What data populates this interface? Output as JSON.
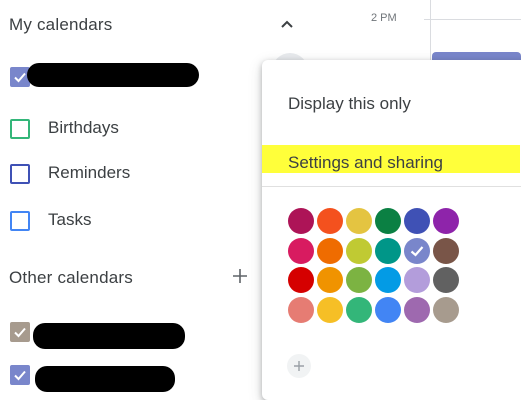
{
  "sidebar": {
    "my_calendars_title": "My calendars",
    "other_calendars_title": "Other calendars",
    "my_calendars": [
      {
        "label": "",
        "color": "#7986cb",
        "checked": true,
        "redacted": true
      },
      {
        "label": "Birthdays",
        "color": "#33b679",
        "checked": false
      },
      {
        "label": "Reminders",
        "color": "#3f51b5",
        "checked": false
      },
      {
        "label": "Tasks",
        "color": "#4285f4",
        "checked": false
      }
    ],
    "other_calendars": [
      {
        "label": "",
        "color": "#a79b8e",
        "checked": true,
        "redacted": true
      },
      {
        "label": "",
        "color": "#7986cb",
        "checked": true,
        "redacted": true
      }
    ]
  },
  "timegrid": {
    "time_label": "2 PM"
  },
  "menu": {
    "display_only": "Display this only",
    "settings_sharing": "Settings and sharing",
    "highlight_color": "#ffff3a",
    "colors": [
      [
        "#ad1457",
        "#f4511e",
        "#e4c441",
        "#0b8043",
        "#3f51b5",
        "#8e24aa"
      ],
      [
        "#d81b60",
        "#ef6c00",
        "#c0ca33",
        "#009688",
        "#7986cb",
        "#795548"
      ],
      [
        "#d50000",
        "#f09300",
        "#7cb342",
        "#039be5",
        "#b39ddb",
        "#616161"
      ],
      [
        "#e67c73",
        "#f6bf26",
        "#33b679",
        "#4285f4",
        "#9e69af",
        "#a79b8e"
      ]
    ],
    "selected_color": "#7986cb"
  }
}
